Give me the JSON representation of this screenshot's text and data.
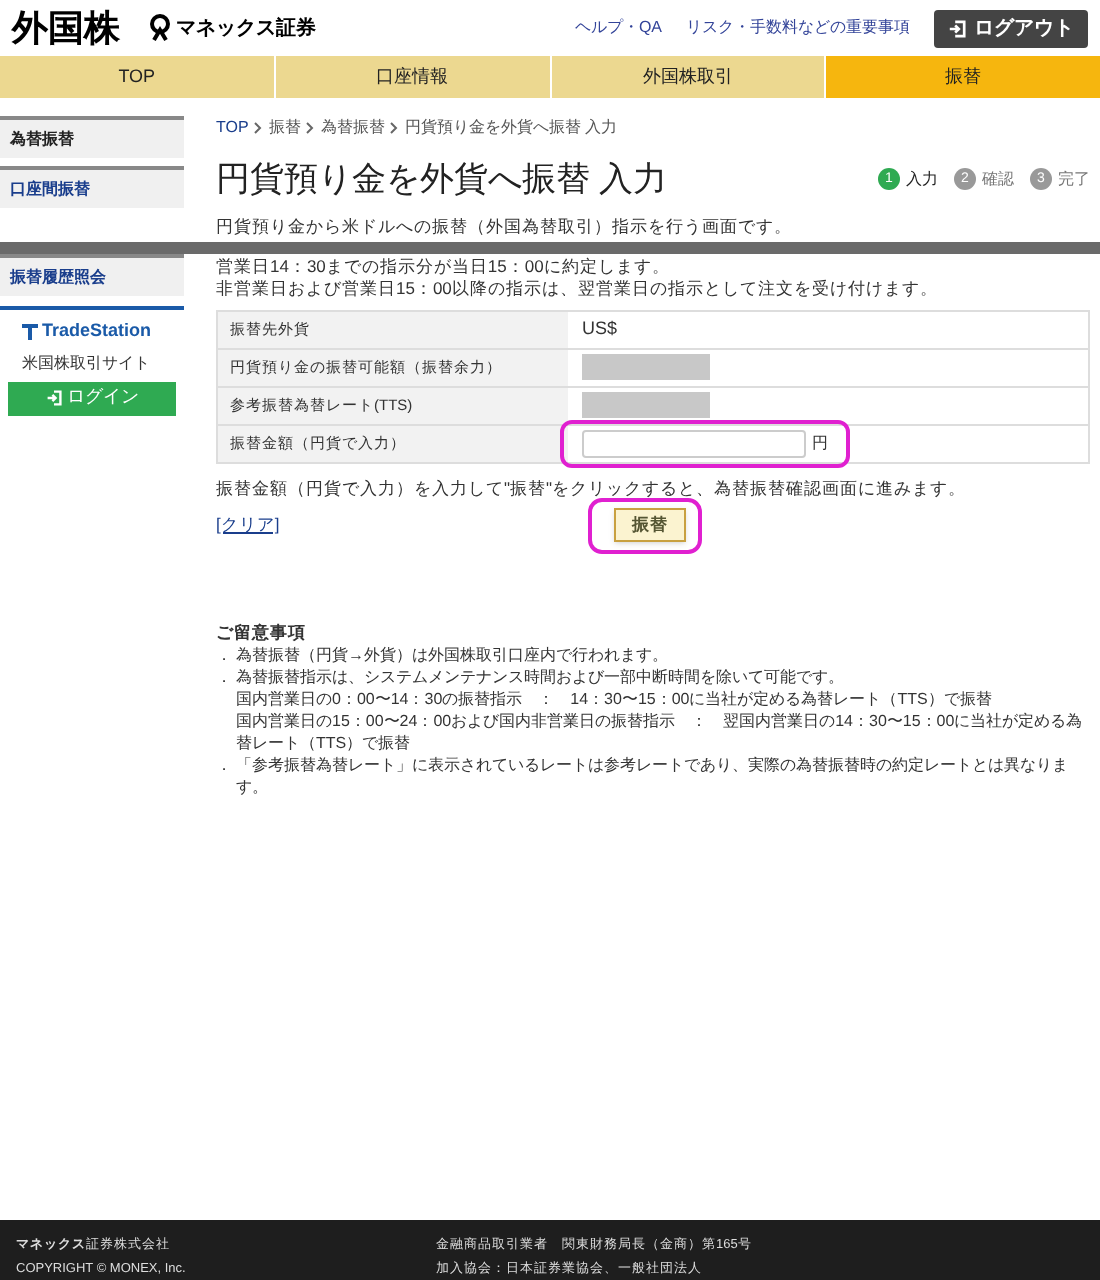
{
  "header": {
    "title": "外国株",
    "brand": "マネックス証券",
    "links": [
      "ヘルプ・QA",
      "リスク・手数料などの重要事項"
    ],
    "logout": "ログアウト"
  },
  "nav": [
    {
      "label": "TOP",
      "selected": false
    },
    {
      "label": "口座情報",
      "selected": false
    },
    {
      "label": "外国株取引",
      "selected": false
    },
    {
      "label": "振替",
      "selected": true
    }
  ],
  "sidebar": {
    "items": [
      {
        "label": "為替振替",
        "selected": true
      },
      {
        "label": "口座間振替",
        "selected": false
      },
      {
        "label": "振替履歴照会",
        "selected": false
      }
    ],
    "tradestation": {
      "logo": "TradeStation",
      "caption": "米国株取引サイト",
      "button": "ログイン"
    }
  },
  "breadcrumb": [
    "TOP",
    "振替",
    "為替振替",
    "円貨預り金を外貨へ振替 入力"
  ],
  "page_title": "円貨預り金を外貨へ振替 入力",
  "steps": [
    {
      "number": "1",
      "label": "入力",
      "selected": true
    },
    {
      "number": "2",
      "label": "確認",
      "selected": false
    },
    {
      "number": "3",
      "label": "完了",
      "selected": false
    }
  ],
  "intro": [
    "円貨預り金から米ドルへの振替（外国為替取引）指示を行う画面です。",
    "営業日14：30までの指示分が当日15：00に約定します。",
    "非営業日および営業日15：00以降の指示は、翌営業日の指示として注文を受け付けます。"
  ],
  "form": [
    {
      "kind": "text",
      "label": "振替先外貨",
      "value": "US$"
    },
    {
      "kind": "masked",
      "label": "円貨預り金の振替可能額（振替余力）"
    },
    {
      "kind": "masked",
      "label": "参考振替為替レート(TTS)"
    },
    {
      "kind": "input",
      "label": "振替金額（円貨で入力）",
      "unit": "円"
    }
  ],
  "hint": "振替金額（円貨で入力）を入力して\"振替\"をクリックすると、為替振替確認画面に進みます。",
  "clear_link": "[クリア]",
  "submit": "振替",
  "notes": {
    "title": "ご留意事項",
    "items": [
      {
        "bullet": "．",
        "text": "為替振替（円貨→外貨）は外国株取引口座内で行われます。"
      },
      {
        "bullet": "．",
        "text": "為替振替指示は、システムメンテナンス時間および一部中断時間を除いて可能です。"
      },
      {
        "text": "国内営業日の0：00〜14：30の振替指示　：　14：30〜15：00に当社が定める為替レート（TTS）で振替"
      },
      {
        "text": "国内営業日の15：00〜24：00および国内非営業日の振替指示　：　翌国内営業日の14：30〜15：00に当社が定める為替レート（TTS）で振替"
      },
      {
        "bullet": "．",
        "text": "「参考振替為替レート」に表示されているレートは参考レートであり、実際の為替振替時の約定レートとは異なります。"
      }
    ]
  },
  "footer": {
    "company": "**マネックス**証券株式会社",
    "copyright": "COPYRIGHT © MONEX, Inc.",
    "registration": "金融商品取引業者　関東財務局長（金商）第165号",
    "association": "加入協会：日本証券業協会、一般社団法人"
  }
}
